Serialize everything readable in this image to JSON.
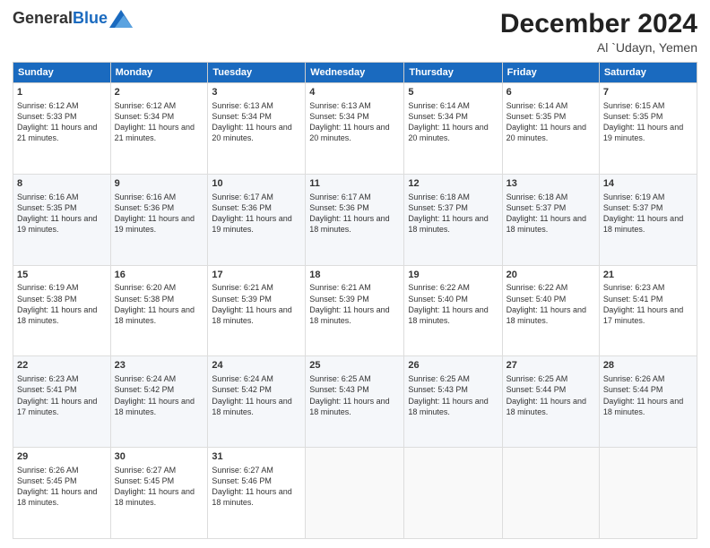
{
  "header": {
    "logo_general": "General",
    "logo_blue": "Blue",
    "month_title": "December 2024",
    "location": "Al `Udayn, Yemen"
  },
  "days_of_week": [
    "Sunday",
    "Monday",
    "Tuesday",
    "Wednesday",
    "Thursday",
    "Friday",
    "Saturday"
  ],
  "weeks": [
    [
      {
        "day": "1",
        "sunrise": "6:12 AM",
        "sunset": "5:33 PM",
        "daylight": "11 hours and 21 minutes."
      },
      {
        "day": "2",
        "sunrise": "6:12 AM",
        "sunset": "5:34 PM",
        "daylight": "11 hours and 21 minutes."
      },
      {
        "day": "3",
        "sunrise": "6:13 AM",
        "sunset": "5:34 PM",
        "daylight": "11 hours and 20 minutes."
      },
      {
        "day": "4",
        "sunrise": "6:13 AM",
        "sunset": "5:34 PM",
        "daylight": "11 hours and 20 minutes."
      },
      {
        "day": "5",
        "sunrise": "6:14 AM",
        "sunset": "5:34 PM",
        "daylight": "11 hours and 20 minutes."
      },
      {
        "day": "6",
        "sunrise": "6:14 AM",
        "sunset": "5:35 PM",
        "daylight": "11 hours and 20 minutes."
      },
      {
        "day": "7",
        "sunrise": "6:15 AM",
        "sunset": "5:35 PM",
        "daylight": "11 hours and 19 minutes."
      }
    ],
    [
      {
        "day": "8",
        "sunrise": "6:16 AM",
        "sunset": "5:35 PM",
        "daylight": "11 hours and 19 minutes."
      },
      {
        "day": "9",
        "sunrise": "6:16 AM",
        "sunset": "5:36 PM",
        "daylight": "11 hours and 19 minutes."
      },
      {
        "day": "10",
        "sunrise": "6:17 AM",
        "sunset": "5:36 PM",
        "daylight": "11 hours and 19 minutes."
      },
      {
        "day": "11",
        "sunrise": "6:17 AM",
        "sunset": "5:36 PM",
        "daylight": "11 hours and 18 minutes."
      },
      {
        "day": "12",
        "sunrise": "6:18 AM",
        "sunset": "5:37 PM",
        "daylight": "11 hours and 18 minutes."
      },
      {
        "day": "13",
        "sunrise": "6:18 AM",
        "sunset": "5:37 PM",
        "daylight": "11 hours and 18 minutes."
      },
      {
        "day": "14",
        "sunrise": "6:19 AM",
        "sunset": "5:37 PM",
        "daylight": "11 hours and 18 minutes."
      }
    ],
    [
      {
        "day": "15",
        "sunrise": "6:19 AM",
        "sunset": "5:38 PM",
        "daylight": "11 hours and 18 minutes."
      },
      {
        "day": "16",
        "sunrise": "6:20 AM",
        "sunset": "5:38 PM",
        "daylight": "11 hours and 18 minutes."
      },
      {
        "day": "17",
        "sunrise": "6:21 AM",
        "sunset": "5:39 PM",
        "daylight": "11 hours and 18 minutes."
      },
      {
        "day": "18",
        "sunrise": "6:21 AM",
        "sunset": "5:39 PM",
        "daylight": "11 hours and 18 minutes."
      },
      {
        "day": "19",
        "sunrise": "6:22 AM",
        "sunset": "5:40 PM",
        "daylight": "11 hours and 18 minutes."
      },
      {
        "day": "20",
        "sunrise": "6:22 AM",
        "sunset": "5:40 PM",
        "daylight": "11 hours and 18 minutes."
      },
      {
        "day": "21",
        "sunrise": "6:23 AM",
        "sunset": "5:41 PM",
        "daylight": "11 hours and 17 minutes."
      }
    ],
    [
      {
        "day": "22",
        "sunrise": "6:23 AM",
        "sunset": "5:41 PM",
        "daylight": "11 hours and 17 minutes."
      },
      {
        "day": "23",
        "sunrise": "6:24 AM",
        "sunset": "5:42 PM",
        "daylight": "11 hours and 18 minutes."
      },
      {
        "day": "24",
        "sunrise": "6:24 AM",
        "sunset": "5:42 PM",
        "daylight": "11 hours and 18 minutes."
      },
      {
        "day": "25",
        "sunrise": "6:25 AM",
        "sunset": "5:43 PM",
        "daylight": "11 hours and 18 minutes."
      },
      {
        "day": "26",
        "sunrise": "6:25 AM",
        "sunset": "5:43 PM",
        "daylight": "11 hours and 18 minutes."
      },
      {
        "day": "27",
        "sunrise": "6:25 AM",
        "sunset": "5:44 PM",
        "daylight": "11 hours and 18 minutes."
      },
      {
        "day": "28",
        "sunrise": "6:26 AM",
        "sunset": "5:44 PM",
        "daylight": "11 hours and 18 minutes."
      }
    ],
    [
      {
        "day": "29",
        "sunrise": "6:26 AM",
        "sunset": "5:45 PM",
        "daylight": "11 hours and 18 minutes."
      },
      {
        "day": "30",
        "sunrise": "6:27 AM",
        "sunset": "5:45 PM",
        "daylight": "11 hours and 18 minutes."
      },
      {
        "day": "31",
        "sunrise": "6:27 AM",
        "sunset": "5:46 PM",
        "daylight": "11 hours and 18 minutes."
      },
      null,
      null,
      null,
      null
    ]
  ]
}
